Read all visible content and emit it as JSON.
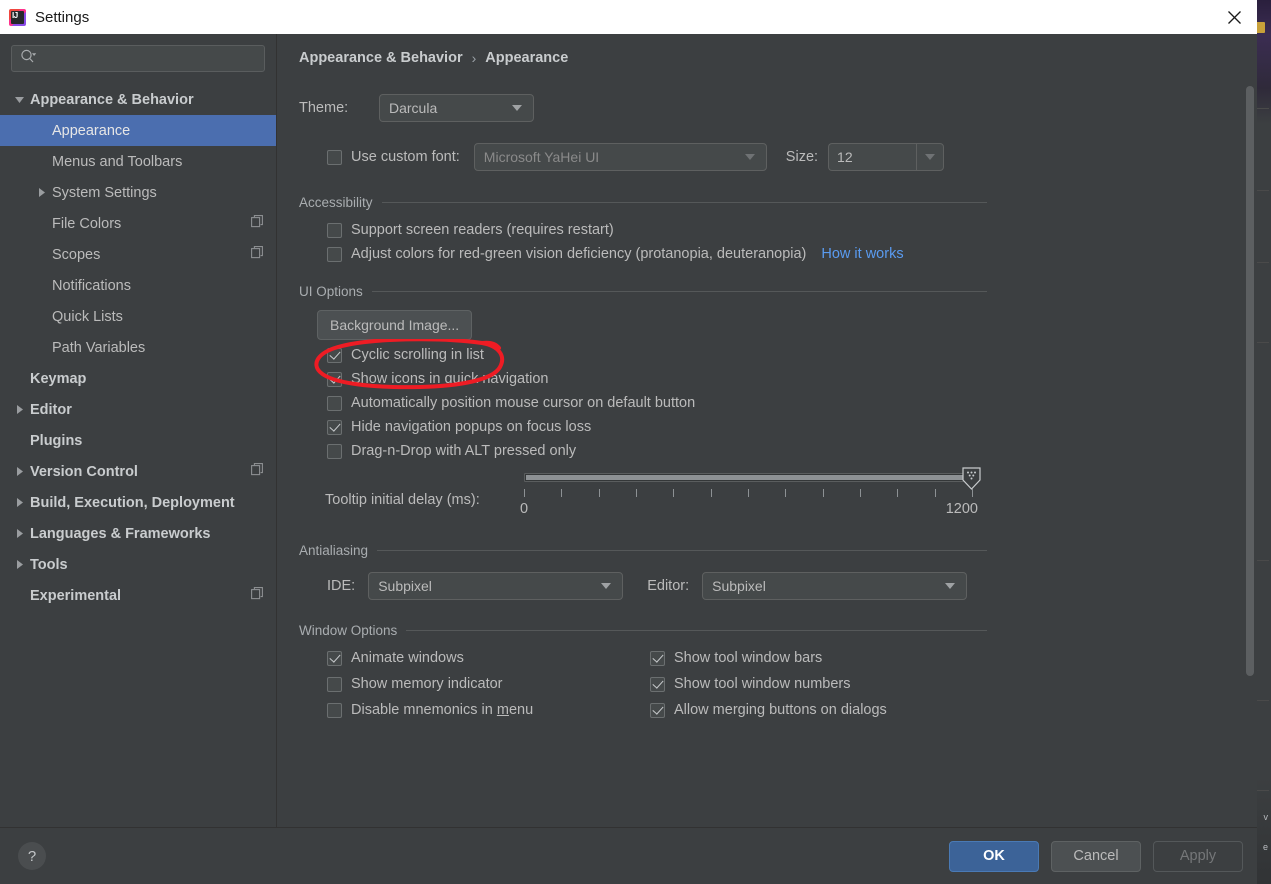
{
  "window": {
    "title": "Settings",
    "app_icon": "intellij-idea-icon",
    "close_icon": "close-icon"
  },
  "sidebar": {
    "search": {
      "placeholder": "",
      "value": "",
      "icon": "search-icon"
    },
    "items": [
      {
        "label": "Appearance & Behavior",
        "level": 0,
        "twisty": "expanded",
        "selected": false,
        "project_icon": false
      },
      {
        "label": "Appearance",
        "level": 1,
        "twisty": "none",
        "selected": true,
        "project_icon": false
      },
      {
        "label": "Menus and Toolbars",
        "level": 1,
        "twisty": "none",
        "selected": false,
        "project_icon": false
      },
      {
        "label": "System Settings",
        "level": 1,
        "twisty": "collapsed",
        "selected": false,
        "project_icon": false
      },
      {
        "label": "File Colors",
        "level": 1,
        "twisty": "none",
        "selected": false,
        "project_icon": true
      },
      {
        "label": "Scopes",
        "level": 1,
        "twisty": "none",
        "selected": false,
        "project_icon": true
      },
      {
        "label": "Notifications",
        "level": 1,
        "twisty": "none",
        "selected": false,
        "project_icon": false
      },
      {
        "label": "Quick Lists",
        "level": 1,
        "twisty": "none",
        "selected": false,
        "project_icon": false
      },
      {
        "label": "Path Variables",
        "level": 1,
        "twisty": "none",
        "selected": false,
        "project_icon": false
      },
      {
        "label": "Keymap",
        "level": 0,
        "twisty": "none",
        "selected": false,
        "project_icon": false
      },
      {
        "label": "Editor",
        "level": 0,
        "twisty": "collapsed",
        "selected": false,
        "project_icon": false
      },
      {
        "label": "Plugins",
        "level": 0,
        "twisty": "none",
        "selected": false,
        "project_icon": false
      },
      {
        "label": "Version Control",
        "level": 0,
        "twisty": "collapsed",
        "selected": false,
        "project_icon": true
      },
      {
        "label": "Build, Execution, Deployment",
        "level": 0,
        "twisty": "collapsed",
        "selected": false,
        "project_icon": false
      },
      {
        "label": "Languages & Frameworks",
        "level": 0,
        "twisty": "collapsed",
        "selected": false,
        "project_icon": false
      },
      {
        "label": "Tools",
        "level": 0,
        "twisty": "collapsed",
        "selected": false,
        "project_icon": false
      },
      {
        "label": "Experimental",
        "level": 0,
        "twisty": "none",
        "selected": false,
        "project_icon": true
      }
    ]
  },
  "breadcrumb": {
    "parent": "Appearance & Behavior",
    "separator": "›",
    "current": "Appearance"
  },
  "main": {
    "theme": {
      "label": "Theme:",
      "value": "Darcula"
    },
    "custom_font": {
      "checkbox_label": "Use custom font:",
      "checked": false,
      "font_value": "Microsoft YaHei UI",
      "size_label": "Size:",
      "size_value": "12"
    },
    "accessibility": {
      "title": "Accessibility",
      "options": [
        {
          "label": "Support screen readers (requires restart)",
          "checked": false
        },
        {
          "label": "Adjust colors for red-green vision deficiency (protanopia, deuteranopia)",
          "checked": false
        }
      ],
      "link": "How it works"
    },
    "ui_options": {
      "title": "UI Options",
      "background_image_button": "Background Image...",
      "options": [
        {
          "label": "Cyclic scrolling in list",
          "checked": true
        },
        {
          "label": "Show icons in quick navigation",
          "checked": true
        },
        {
          "label": "Automatically position mouse cursor on default button",
          "checked": false
        },
        {
          "label": "Hide navigation popups on focus loss",
          "checked": true
        },
        {
          "label": "Drag-n-Drop with ALT pressed only",
          "checked": false
        }
      ],
      "tooltip_delay": {
        "label": "Tooltip initial delay (ms):",
        "min": "0",
        "max": "1200",
        "value": 1200,
        "tick_count": 13
      }
    },
    "antialiasing": {
      "title": "Antialiasing",
      "ide_label": "IDE:",
      "ide_value": "Subpixel",
      "editor_label": "Editor:",
      "editor_value": "Subpixel"
    },
    "window_options": {
      "title": "Window Options",
      "left_column": [
        {
          "label": "Animate windows",
          "checked": true
        },
        {
          "label": "Show memory indicator",
          "checked": false
        },
        {
          "label": "Disable mnemonics in menu",
          "checked": false,
          "mnemonic": "m"
        }
      ],
      "right_column": [
        {
          "label": "Show tool window bars",
          "checked": true
        },
        {
          "label": "Show tool window numbers",
          "checked": true
        },
        {
          "label": "Allow merging buttons on dialogs",
          "checked": true
        }
      ]
    }
  },
  "footer": {
    "help_label": "?",
    "ok": "OK",
    "cancel": "Cancel",
    "apply": "Apply",
    "apply_disabled": true
  },
  "annotation": {
    "type": "hand-drawn-ellipse",
    "color": "#ee1c24",
    "targets": "Background Image... button"
  },
  "colors": {
    "window_bg": "#3c3f41",
    "titlebar_bg": "#ffffff",
    "selection_blue": "#4b6eaf",
    "text": "#bbbbbb",
    "link_blue": "#5a9bf0",
    "primary_button": "#3c6398",
    "annotation_red": "#ee1c24"
  }
}
